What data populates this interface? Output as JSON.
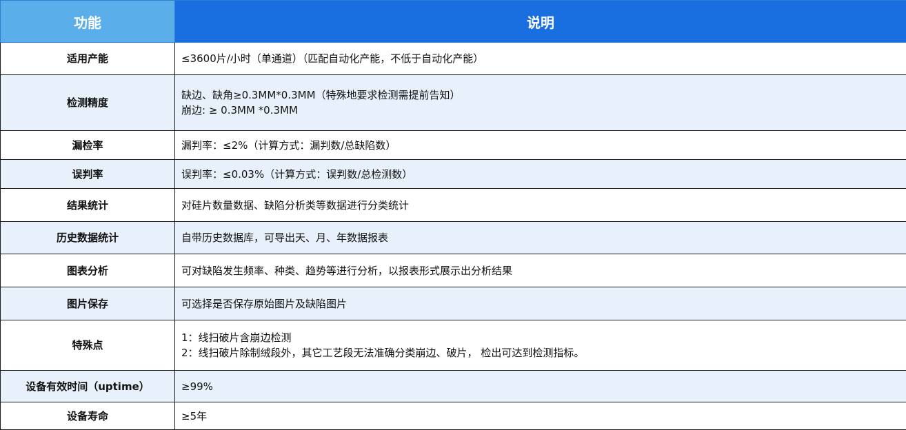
{
  "header": {
    "function_label": "功能",
    "description_label": "说明"
  },
  "colors": {
    "header_left": "#5aaeea",
    "header_right": "#1a6fe0",
    "row_alt": "#e8f1fb"
  },
  "rows": [
    {
      "function": "适用产能",
      "lines": [
        "≤3600片/小时（单通道）（匹配自动化产能，不低于自动化产能）"
      ]
    },
    {
      "function": "检测精度",
      "lines": [
        "缺边、缺角≥0.3MM*0.3MM（特殊地要求检测需提前告知）",
        "崩边: ≥ 0.3MM *0.3MM"
      ]
    },
    {
      "function": "漏检率",
      "lines": [
        "漏判率：≤2%（计算方式：漏判数/总缺陷数）"
      ]
    },
    {
      "function": "误判率",
      "lines": [
        "误判率：≤0.03%（计算方式：误判数/总检测数）"
      ]
    },
    {
      "function": "结果统计",
      "lines": [
        "对硅片数量数据、缺陷分析类等数据进行分类统计"
      ]
    },
    {
      "function": "历史数据统计",
      "lines": [
        "自带历史数据库，可导出天、月、年数据报表"
      ]
    },
    {
      "function": "图表分析",
      "lines": [
        "可对缺陷发生频率、种类、趋势等进行分析，以报表形式展示出分析结果"
      ]
    },
    {
      "function": "图片保存",
      "lines": [
        "可选择是否保存原始图片及缺陷图片"
      ]
    },
    {
      "function": "特殊点",
      "lines": [
        "1：线扫破片含崩边检测",
        "2：线扫破片除制绒段外，其它工艺段无法准确分类崩边、破片， 检出可达到检测指标。"
      ]
    },
    {
      "function": "设备有效时间（uptime）",
      "lines": [
        "≥99%"
      ]
    },
    {
      "function": "设备寿命",
      "lines": [
        "≥5年"
      ]
    }
  ]
}
